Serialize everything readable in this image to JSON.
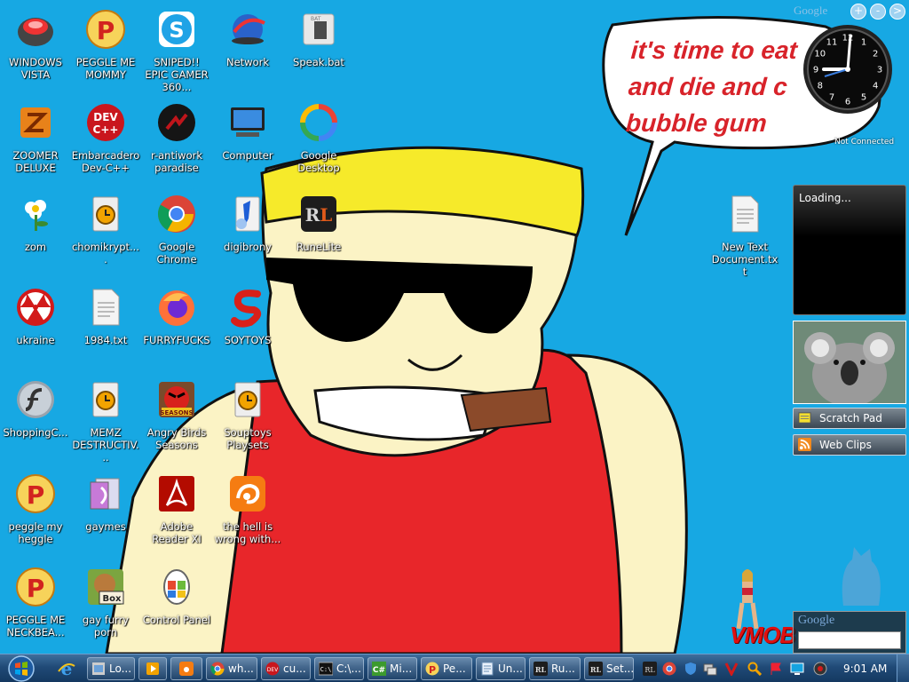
{
  "desktop_icons": [
    {
      "label": "WINDOWS VISTA",
      "icon": "vista-pod-icon"
    },
    {
      "label": "PEGGLE ME MOMMY",
      "icon": "peggle-icon"
    },
    {
      "label": "SNIPED!! EPIC GAMER 360...",
      "icon": "skype-icon"
    },
    {
      "label": "Network",
      "icon": "network-icon"
    },
    {
      "label": "Speak.bat",
      "icon": "bat-file-icon"
    },
    {
      "label": "ZOOMER DELUXE",
      "icon": "zoomer-icon"
    },
    {
      "label": "Embarcadero Dev-C++",
      "icon": "devcpp-icon"
    },
    {
      "label": "r-antiwork paradise",
      "icon": "antiwork-icon"
    },
    {
      "label": "Computer",
      "icon": "computer-icon"
    },
    {
      "label": "Google Desktop",
      "icon": "google-desktop-icon"
    },
    {
      "label": "zom",
      "icon": "flower-icon"
    },
    {
      "label": "chomikrypt....",
      "icon": "clock-file-icon"
    },
    {
      "label": "Google Chrome",
      "icon": "chrome-icon"
    },
    {
      "label": "digibrony",
      "icon": "digibrony-icon"
    },
    {
      "label": "RuneLite",
      "icon": "runelite-icon"
    },
    {
      "label": "New Text Document.txt",
      "icon": "text-file-icon"
    },
    {
      "label": "ukraine",
      "icon": "radiation-icon"
    },
    {
      "label": "1984.txt",
      "icon": "text-file-icon"
    },
    {
      "label": "FURRYFUCKS",
      "icon": "firefox-icon"
    },
    {
      "label": "SOYTOYS",
      "icon": "soytoys-icon"
    },
    {
      "label": "ShoppingC...",
      "icon": "flash-icon"
    },
    {
      "label": "MEMZ DESTRUCTIV...",
      "icon": "clock-file-icon"
    },
    {
      "label": "Angry Birds Seasons",
      "icon": "angry-birds-icon"
    },
    {
      "label": "Souptoys Playsets",
      "icon": "clock-file-icon"
    },
    {
      "label": "peggle my heggle",
      "icon": "peggle-icon"
    },
    {
      "label": "gaymes",
      "icon": "games-folder-icon"
    },
    {
      "label": "Adobe Reader XI",
      "icon": "adobe-reader-icon"
    },
    {
      "label": "the hell is wrong with...",
      "icon": "uc-browser-icon"
    },
    {
      "label": "PEGGLE ME NECKBEA...",
      "icon": "peggle-icon"
    },
    {
      "label": "gay furry porn",
      "icon": "box-dog-icon"
    },
    {
      "label": "Control Panel",
      "icon": "control-panel-icon"
    }
  ],
  "wallpaper": {
    "speech_text": [
      "it's time to eat",
      "and die and c",
      "bubble gum"
    ]
  },
  "gadgets": {
    "google_logo": "Google",
    "top_buttons": [
      "+",
      "-",
      ">"
    ],
    "clock_status": "Not Connected",
    "clock_face_numbers": [
      "12",
      "1",
      "2",
      "3",
      "4",
      "5",
      "6",
      "7",
      "8",
      "9",
      "10",
      "11"
    ],
    "loading_text": "Loading...",
    "scratch_pad": "Scratch Pad",
    "web_clips": "Web Clips",
    "search_logo": "Google",
    "vmob_text": "VMOB"
  },
  "taskbar": {
    "tasks": [
      {
        "label": "Lo...",
        "icon": "explorer-icon"
      },
      {
        "label": "",
        "icon": "media-player-icon"
      },
      {
        "label": "",
        "icon": "uc-browser-icon"
      },
      {
        "label": "wh...",
        "icon": "chrome-icon"
      },
      {
        "label": "cu...",
        "icon": "devcpp-icon"
      },
      {
        "label": "C:\\...",
        "icon": "cmd-icon"
      },
      {
        "label": "Mi...",
        "icon": "csharp-icon"
      },
      {
        "label": "Pe...",
        "icon": "peggle-icon"
      },
      {
        "label": "Un...",
        "icon": "notepad-icon"
      },
      {
        "label": "Ru...",
        "icon": "runelite-icon"
      },
      {
        "label": "Set...",
        "icon": "runelite-icon"
      }
    ],
    "time": "9:01 AM"
  },
  "colors": {
    "desktop_bg": "#17a8e3",
    "speech_red": "#d8232a",
    "bandana_yellow": "#f6ea2a",
    "skin": "#fbf3c5",
    "shirt_red": "#e8262a",
    "cigar": "#8b4a2a"
  }
}
